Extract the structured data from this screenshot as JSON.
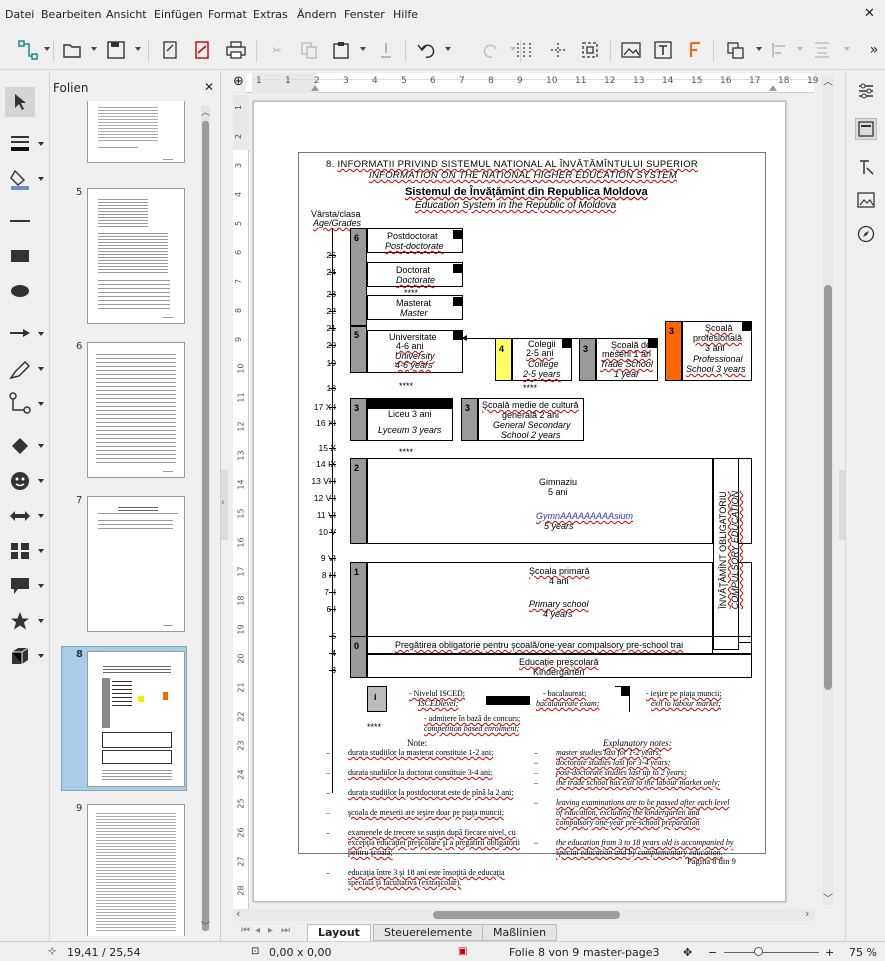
{
  "menu": [
    "Datei",
    "Bearbeiten",
    "Ansicht",
    "Einfügen",
    "Format",
    "Extras",
    "Ändern",
    "Fenster",
    "Hilfe"
  ],
  "slide_panel": {
    "title": "Folien",
    "thumb_numbers": [
      "5",
      "6",
      "7",
      "8",
      "9"
    ]
  },
  "tabs": [
    "Layout",
    "Steuerelemente",
    "Maßlinien"
  ],
  "status": {
    "position": "19,41 / 25,54",
    "size": "0,00 x 0,00",
    "slide": "Folie 8 von 9",
    "master": "master-page3",
    "zoom": "75 %"
  },
  "ruler": {
    "h": [
      "1",
      "1",
      "2",
      "3",
      "4",
      "5",
      "6",
      "7",
      "8",
      "9",
      "10",
      "11",
      "12",
      "13",
      "14",
      "15",
      "16",
      "17",
      "18",
      "19"
    ],
    "v": [
      "1",
      "2",
      "3",
      "4",
      "5",
      "6",
      "7",
      "8",
      "9",
      "10",
      "11",
      "12",
      "13",
      "14",
      "15",
      "16",
      "17",
      "18",
      "19",
      "20",
      "21",
      "22",
      "23",
      "24",
      "25",
      "26",
      "27",
      "28"
    ]
  },
  "doc": {
    "heading1_num": "8. ",
    "heading1": "INFORMATII PRIVIND SISTEMUL NATIONAL AL  ÎNVĂTĂMÎNTULUI SUPERIOR",
    "heading2": "INFORMATION ON THE NATIONAL HIGHER EDUCATION SYSTEM",
    "title_ro": "Sistemul de Învăţămînt din Republica Moldova",
    "title_en": "Education System in the Republic of Moldova",
    "age_label_1": "Vârsta/clasa",
    "age_label_2": "Age/Grades",
    "ages": [
      {
        "t": "25"
      },
      {
        "t": "24"
      },
      {
        "t": "23"
      },
      {
        "t": "22"
      },
      {
        "t": "21"
      },
      {
        "t": "20"
      },
      {
        "t": "19"
      },
      {
        "t": "18"
      },
      {
        "t": "17 XII"
      },
      {
        "t": "16 XI"
      },
      {
        "t": "15 X"
      },
      {
        "t": "14 IX"
      },
      {
        "t": "13 VIII"
      },
      {
        "t": "12 VII"
      },
      {
        "t": "11 VI"
      },
      {
        "t": "10 V"
      },
      {
        "t": "9 VI"
      },
      {
        "t": "8 III"
      },
      {
        "t": "7 II"
      },
      {
        "t": "6 I"
      },
      {
        "t": "5"
      },
      {
        "t": "4"
      },
      {
        "t": "3"
      }
    ],
    "lvl": {
      "l6": "6",
      "l5": "5",
      "l4": "4",
      "l3a": "3",
      "l3b": "3",
      "l3c": "3",
      "l3d": "3",
      "l2": "2",
      "l1": "1",
      "l0": "0"
    },
    "postdoc": [
      "Postdoctorat",
      "Post-doctorate"
    ],
    "doc": [
      "Doctorat",
      "Doctorate"
    ],
    "master": [
      "Masterat",
      "Master"
    ],
    "stars": "****",
    "univ": [
      "Universitate",
      "4-6 ani",
      "University",
      "4-6 years"
    ],
    "colegii": [
      "Colegii",
      "2-5 ani",
      "College",
      "2-5 years"
    ],
    "meserii": [
      "Şcoală de",
      "meserii 1 an",
      "Trade School",
      "1 year"
    ],
    "prof": [
      "Şcoală",
      "profesională",
      "3 ani",
      "Professional",
      "School 3 years"
    ],
    "liceu": [
      "Liceu 3 ani",
      "Lyceum 3 years"
    ],
    "medie": [
      "Şcoală medie de cultură",
      "generală 2 ani",
      "General Secondary",
      "School 2 years"
    ],
    "gimnaziu": [
      "Gimnaziu",
      "5 ani",
      "GymnAAAAAAAAAsium",
      "5 years"
    ],
    "primara": [
      "Şcoala primară",
      "4 ani",
      "Primary school",
      "4 years"
    ],
    "oblig": [
      "ÎNVĂŢĂMÎNT OBLIGATORIU",
      "COMPULSORY EDUCATION"
    ],
    "pregatire": "Pregătirea obligatorie pentru şcoală/one-year compalsory pre-school trai",
    "presc": [
      "Educaţie preşcolară",
      "Kindergarten"
    ],
    "legend_i": "i",
    "legend": [
      "- Nivelul ISCED;",
      "ISCEDlevel;",
      "- bacalaureat;",
      "bacalaureate exam;",
      "- ieşire pe piaţa muncii;",
      "exit to labour market;"
    ],
    "legend_stars": "****",
    "legend_admit": [
      "- admitere în bază de concurs;",
      "competition based enrolment;"
    ],
    "notes_title": "Note:",
    "notes_title_en": "Explanatory notes:",
    "notes_ro": [
      "durata studiilor la masterat constituie 1-2 ani;",
      "durata studiilor la doctorat constituie 3-4 ani;",
      "durata studiilor la postdoctorat este de pînă la 2 ani;",
      "şcoala de meserii are ieşire doar pe piaţa muncii;",
      "examenele de trecere se susţin după fiecare nivel, cu excepţia educaţiei preşcolare şi a pregătirii obligatorii pentru şcoală;",
      "educaţia între 3 şi 18 ani este însoţită de educaţia specială şi facultativă (extraşcolar)."
    ],
    "notes_en": [
      "master studies last for 1-2 years;",
      "doctorate studies last for 3-4 years;",
      "post-doctorate studies last up to 2 years;",
      "the trade school has exit to the labour market only;",
      "leaving examinations are to be passed after each level of education, excluding the kindergarten and compulsory one-year pre-school preparation",
      "the education from 3 to 18 years old is accompanied by special education and by complementary education."
    ],
    "page": "Pagina 8 din 9"
  },
  "colors": {
    "gray": "#9a9a9a",
    "yellow": "#ffff66",
    "orange": "#ff6600",
    "selected": "#a9cde6",
    "gym_blue": "#3333cc"
  }
}
